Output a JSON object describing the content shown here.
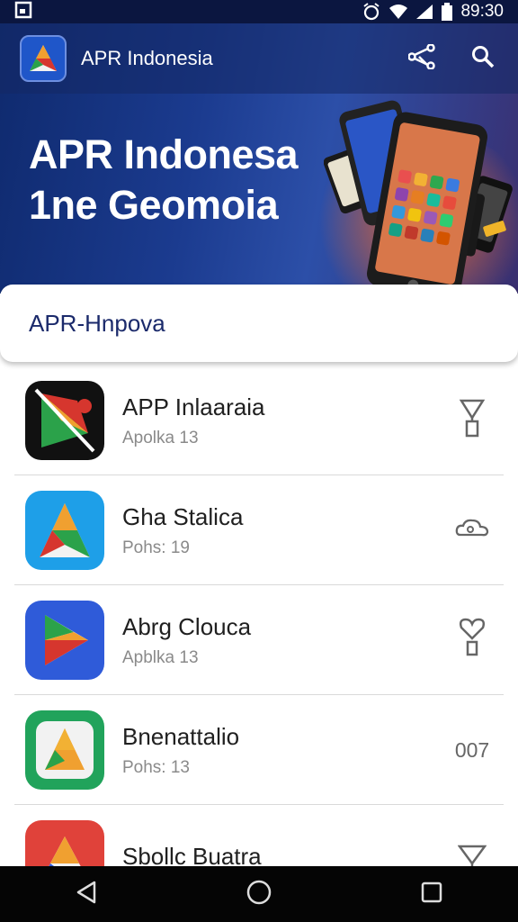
{
  "status_bar": {
    "time": "89:30"
  },
  "app_bar": {
    "title": "APR Indonesia"
  },
  "hero": {
    "line1": "APR Indonesa",
    "line2": "1ne Geomoia"
  },
  "search": {
    "text": "APR-Hnpova"
  },
  "apps": [
    {
      "name": "APP Inlaaraia",
      "sub": "Apolka 13",
      "action": ""
    },
    {
      "name": "Gha Stalica",
      "sub": "Pohs: 19",
      "action": ""
    },
    {
      "name": "Abrg Clouca",
      "sub": "Apblka 13",
      "action": ""
    },
    {
      "name": "Bnenattalio",
      "sub": "Pohs: 13",
      "action": "007"
    },
    {
      "name": "Sbollc Buatra",
      "sub": "",
      "action": ""
    }
  ],
  "colors": {
    "status_bar": "#0b1640",
    "hero_start": "#0f2a6e",
    "search_text": "#1b2a6b",
    "nav_bar": "#050505"
  },
  "icons": {
    "status": [
      "screenshot-icon",
      "alarm-icon",
      "wifi-icon",
      "signal-icon",
      "battery-icon"
    ],
    "app_bar": [
      "share-icon",
      "search-icon"
    ],
    "nav": [
      "back-icon",
      "home-icon",
      "recents-icon"
    ]
  }
}
